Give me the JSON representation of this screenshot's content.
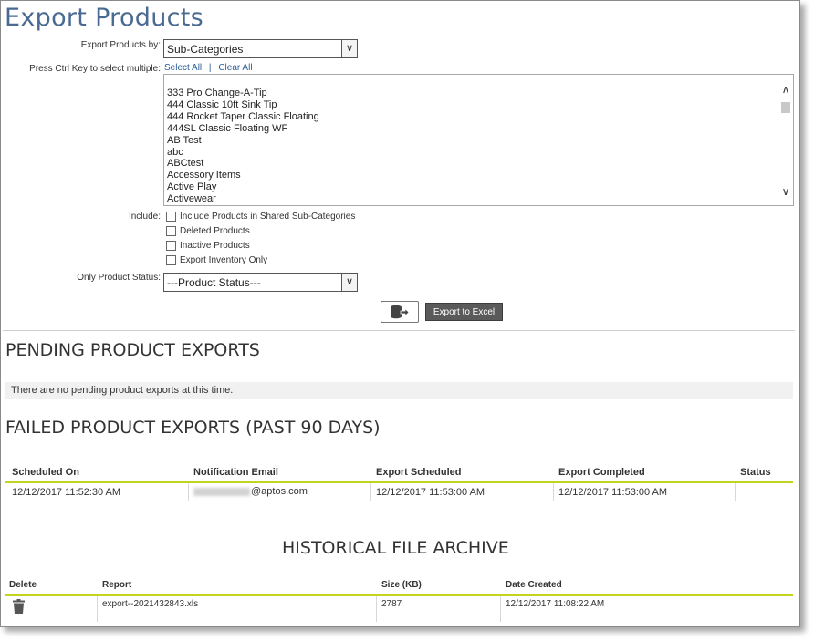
{
  "page": {
    "title": "Export Products"
  },
  "form": {
    "export_by_label": "Export Products by:",
    "export_by_value": "Sub-Categories",
    "ctrl_hint": "Press Ctrl Key to select multiple:",
    "select_all": "Select All",
    "separator": "|",
    "clear_all": "Clear All",
    "list_items": [
      "333 Pro Change-A-Tip",
      "444 Classic 10ft Sink Tip",
      "444 Rocket Taper Classic Floating",
      "444SL Classic Floating WF",
      "AB Test",
      "abc",
      "ABCtest",
      "Accessory Items",
      "Active Play",
      "Activewear"
    ],
    "include_label": "Include:",
    "include_options": [
      "Include Products in Shared Sub-Categories",
      "Deleted Products",
      "Inactive Products",
      "Export Inventory Only"
    ],
    "status_label": "Only Product Status:",
    "status_value": "---Product Status---",
    "export_button": "Export to Excel"
  },
  "pending": {
    "heading": "PENDING PRODUCT EXPORTS",
    "notice": "There are no pending product exports at this time."
  },
  "failed": {
    "heading": "FAILED PRODUCT EXPORTS (PAST 90 DAYS)",
    "columns": [
      "Scheduled On",
      "Notification Email",
      "Export Scheduled",
      "Export Completed",
      "Status"
    ],
    "rows": [
      {
        "scheduled_on": "12/12/2017 11:52:30 AM",
        "email_domain": "@aptos.com",
        "export_scheduled": "12/12/2017 11:53:00 AM",
        "export_completed": "12/12/2017 11:53:00 AM",
        "status": ""
      }
    ]
  },
  "archive": {
    "heading": "HISTORICAL FILE ARCHIVE",
    "columns": [
      "Delete",
      "Report",
      "Size (KB)",
      "Date Created"
    ],
    "rows": [
      {
        "report": "export--2021432843.xls",
        "size": "2787",
        "date_created": "12/12/2017 11:08:22 AM"
      }
    ]
  },
  "colors": {
    "title": "#4a6a92",
    "link": "#2a5d9a",
    "accent_rule": "#c3d41f",
    "button_bg": "#5a5a5a"
  }
}
